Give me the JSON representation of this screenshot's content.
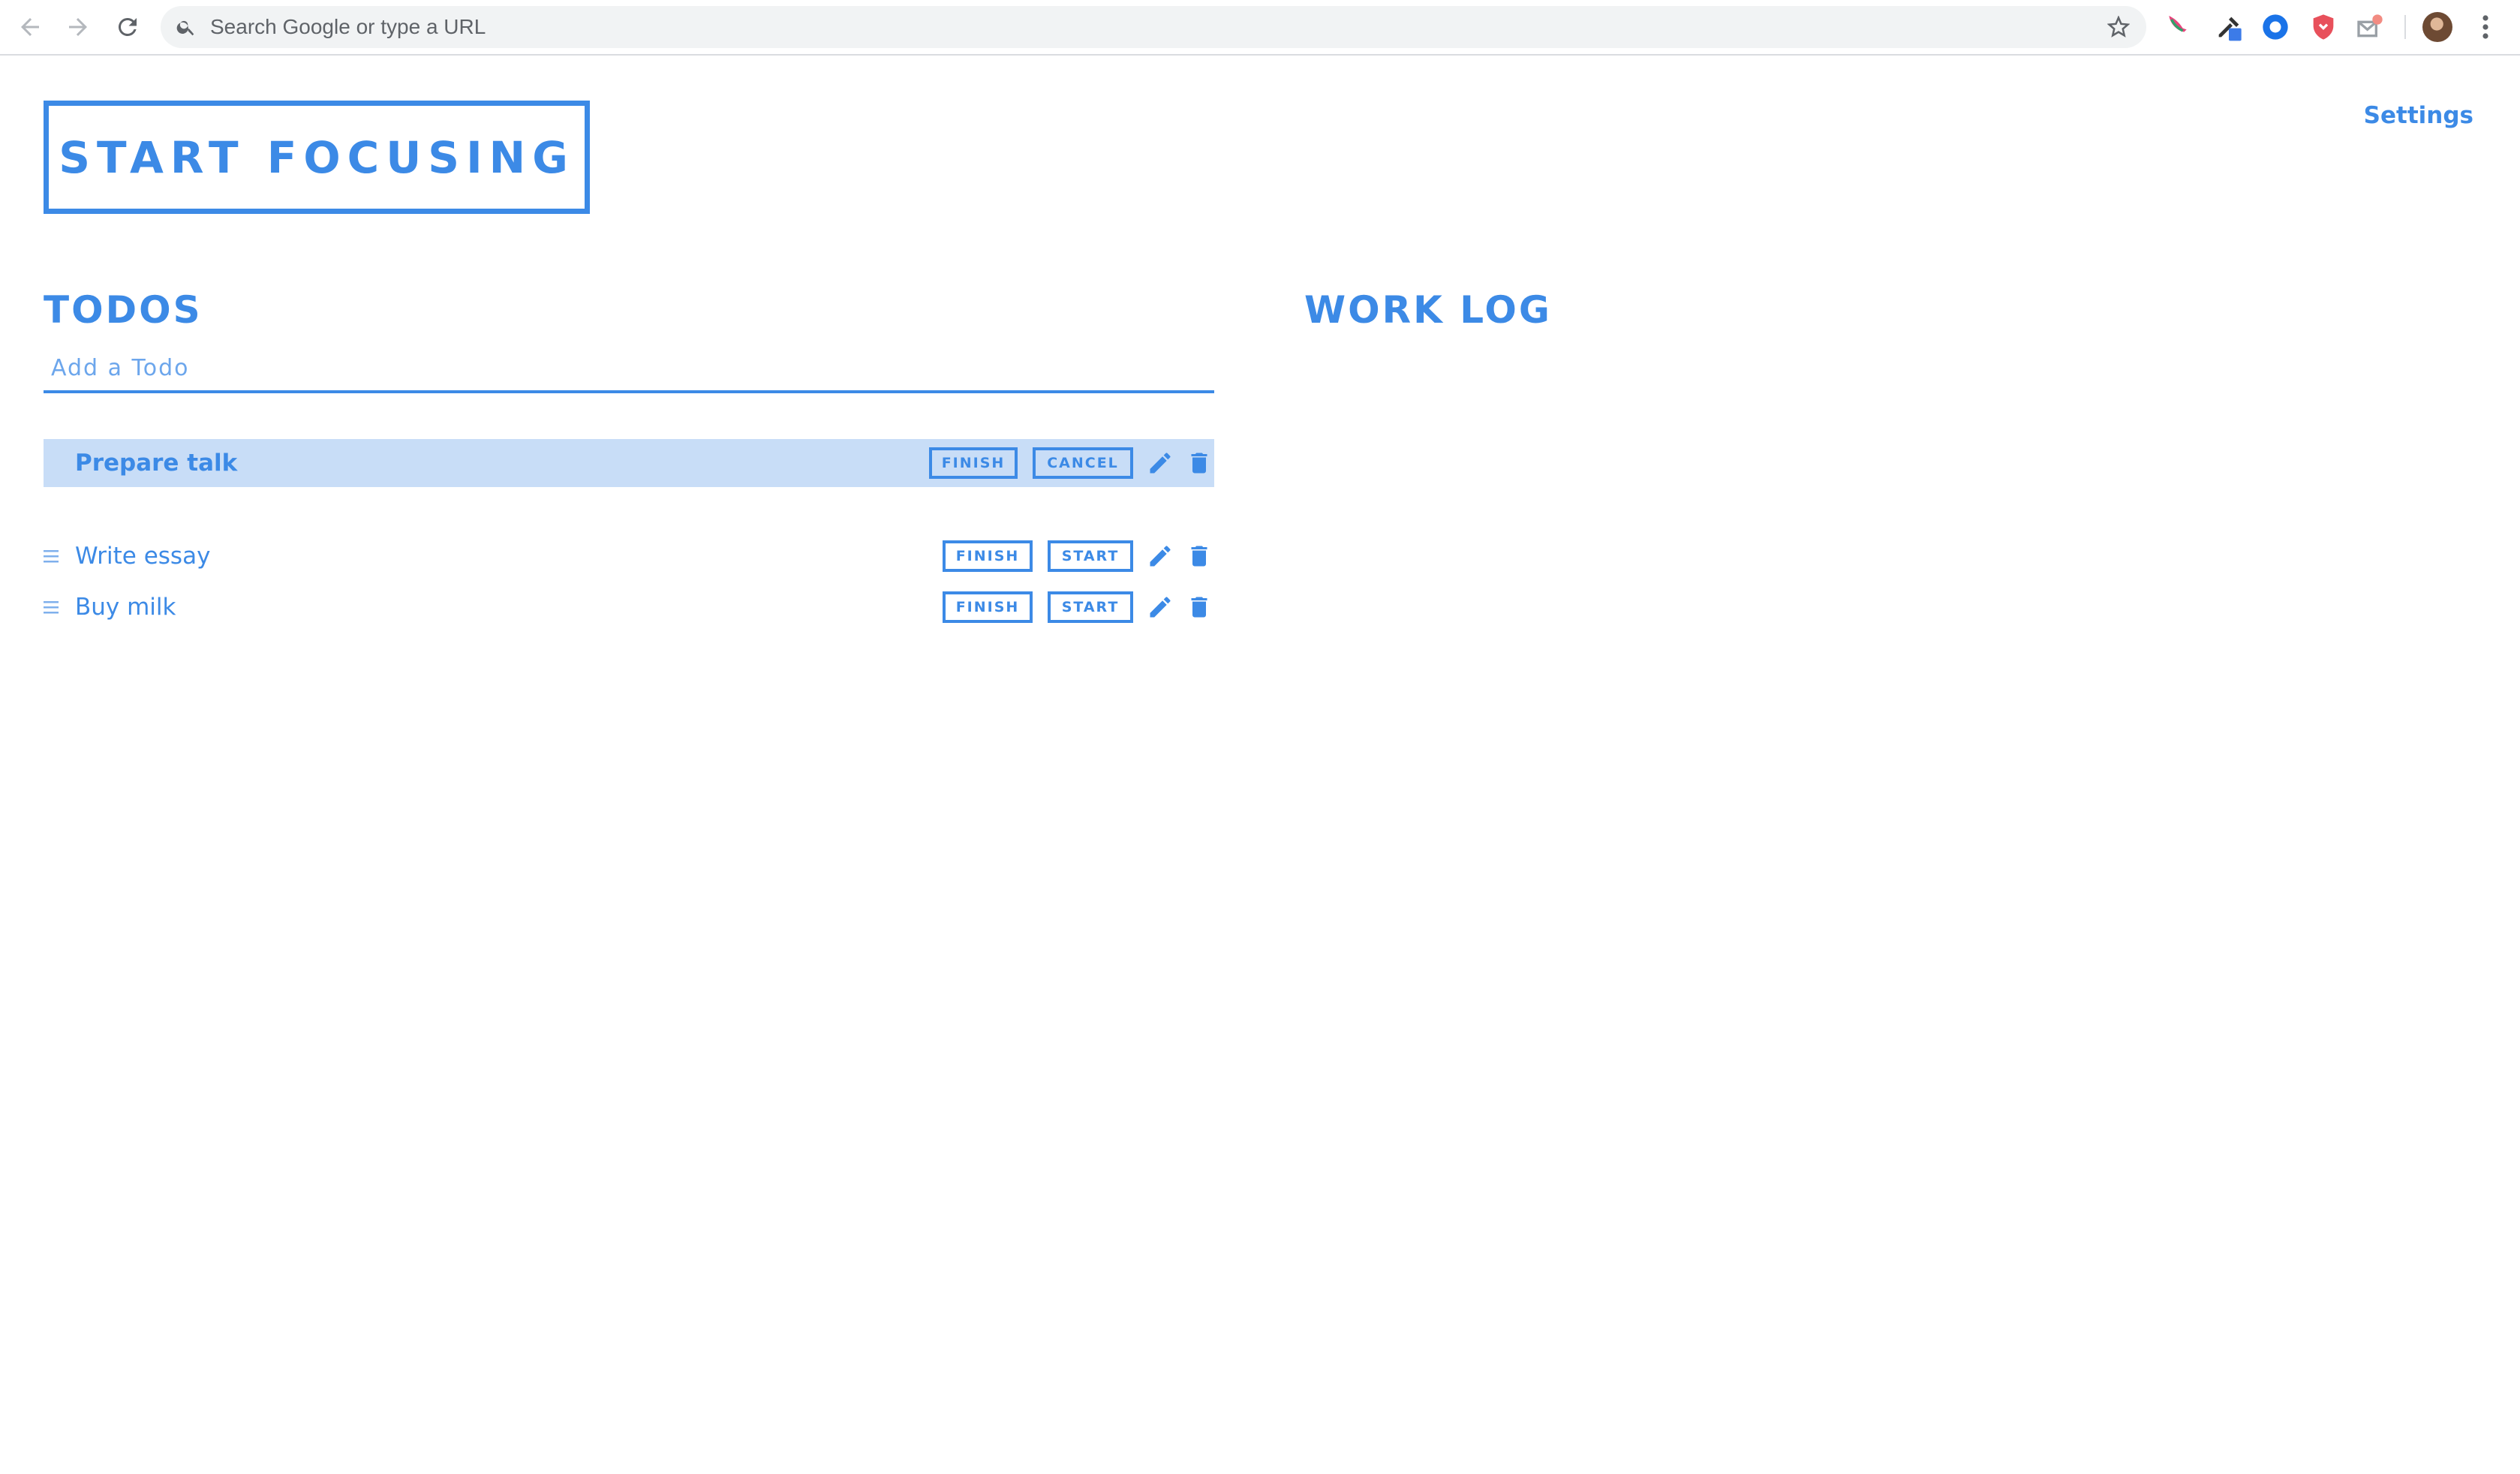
{
  "browser": {
    "omnibox_placeholder": "Search Google or type a URL",
    "icons": {
      "back": "back-arrow-icon",
      "forward": "forward-arrow-icon",
      "reload": "reload-icon",
      "search": "search-icon",
      "bookmark": "star-icon",
      "menu": "more-vert-icon"
    }
  },
  "app": {
    "start_button_label": "START FOCUSING",
    "settings_label": "Settings",
    "theme_toggle_icon": "moon-icon",
    "accent_color": "#3c8ae6",
    "active_row_color": "#c8ddf7"
  },
  "todos": {
    "heading": "TODOS",
    "input_placeholder": "Add a Todo",
    "active": {
      "label": "Prepare talk",
      "finish_label": "FINISH",
      "cancel_label": "CANCEL"
    },
    "items": [
      {
        "label": "Write essay",
        "finish_label": "FINISH",
        "start_label": "START"
      },
      {
        "label": "Buy milk",
        "finish_label": "FINISH",
        "start_label": "START"
      }
    ]
  },
  "work_log": {
    "heading": "WORK LOG"
  }
}
